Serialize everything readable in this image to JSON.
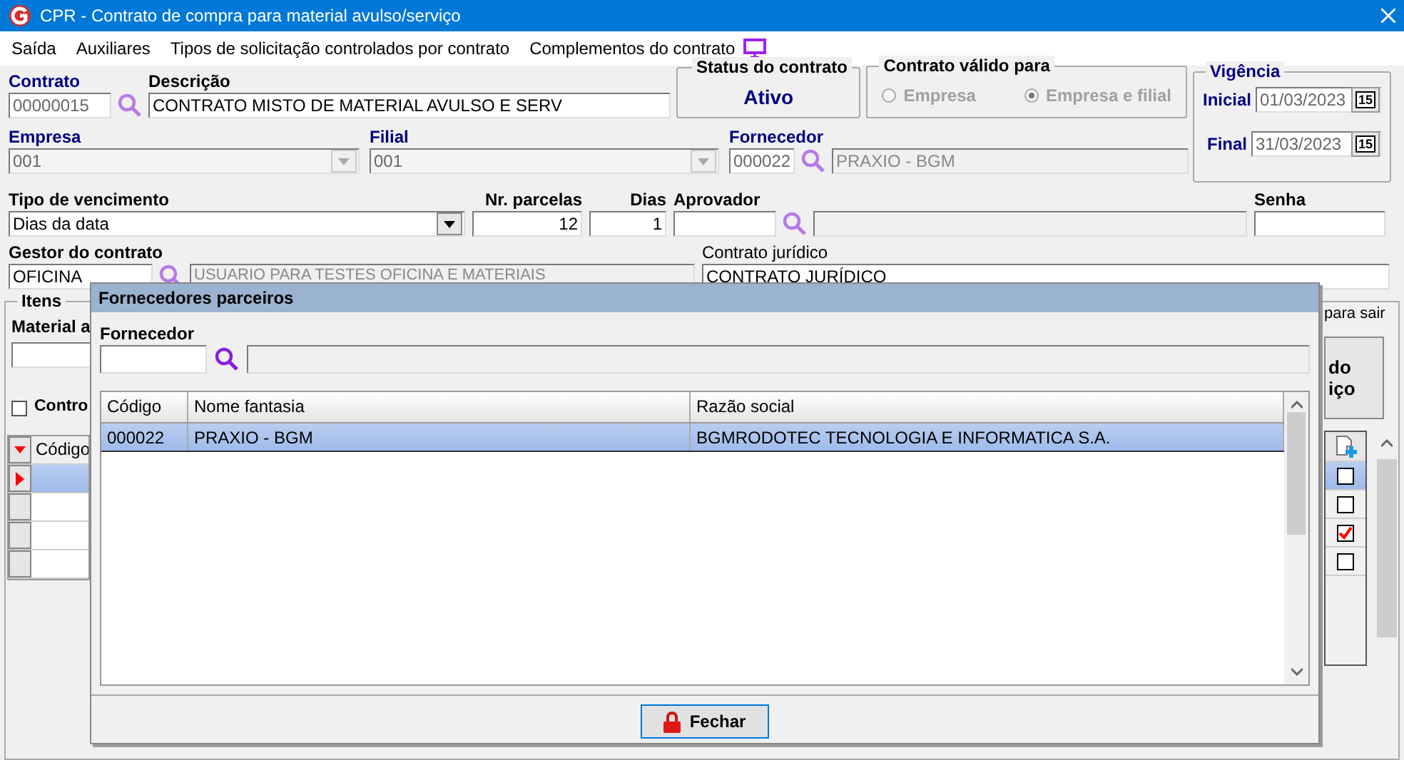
{
  "window": {
    "title": "CPR - Contrato de compra para material avulso/serviço"
  },
  "menu": [
    {
      "label": "Saída",
      "kind": "text"
    },
    {
      "label": "Auxiliares",
      "kind": "text"
    },
    {
      "label": "Tipos de solicitação controlados por contrato",
      "kind": "text"
    },
    {
      "label": "Complementos do contrato",
      "kind": "monitor"
    }
  ],
  "contrato": {
    "label": "Contrato",
    "value": "00000015",
    "required": true
  },
  "descricao": {
    "label": "Descrição",
    "value": "CONTRATO MISTO DE MATERIAL AVULSO E SERV",
    "required": false
  },
  "status": {
    "label": "Status do contrato",
    "value": "Ativo"
  },
  "valido_para": {
    "label": "Contrato válido para",
    "disabled": true,
    "options": [
      {
        "label": "Empresa",
        "selected": false
      },
      {
        "label": "Empresa e filial",
        "selected": true
      }
    ]
  },
  "vigencia": {
    "label": "Vigência",
    "inicial": {
      "label": "Inicial",
      "value": "01/03/2023",
      "calendar_day": "15"
    },
    "final": {
      "label": "Final",
      "value": "31/03/2023",
      "calendar_day": "15"
    }
  },
  "empresa": {
    "label": "Empresa",
    "value": "001",
    "required": true
  },
  "filial": {
    "label": "Filial",
    "value": "001",
    "required": true
  },
  "fornecedor": {
    "label": "Fornecedor",
    "code": "000022",
    "name": "PRAXIO - BGM",
    "required": true
  },
  "tipo_vencimento": {
    "label": "Tipo de vencimento",
    "value": "Dias da data",
    "required": false
  },
  "nr_parcelas": {
    "label": "Nr. parcelas",
    "value": "12",
    "required": false
  },
  "dias": {
    "label": "Dias",
    "value": "1",
    "required": false
  },
  "aprovador": {
    "label": "Aprovador",
    "required": false
  },
  "senha": {
    "label": "Senha",
    "required": false
  },
  "gestor": {
    "label": "Gestor do contrato",
    "value": "OFICINA",
    "name": "USUARIO PARA TESTES OFICINA E MATERIAIS",
    "required": false
  },
  "contrato_juridico": {
    "label": "Contrato jurídico",
    "value": "CONTRATO JURÍDICO"
  },
  "itens": {
    "label": "Itens",
    "material_label": "Material a",
    "checkbox": {
      "label": "Contro",
      "checked": false
    },
    "hint": "para sair",
    "button_lines": [
      "do",
      "iço"
    ],
    "grid": {
      "column_1": "Código",
      "rows": [
        {
          "selected": true,
          "checked": false
        },
        {
          "selected": false,
          "checked": false
        },
        {
          "selected": false,
          "checked": true
        },
        {
          "selected": false,
          "checked": false
        }
      ]
    }
  },
  "dialog": {
    "title": "Fornecedores parceiros",
    "fornecedor_label": "Fornecedor",
    "columns": [
      "Código",
      "Nome fantasia",
      "Razão social"
    ],
    "rows": [
      {
        "cells": [
          "000022",
          "PRAXIO - BGM",
          "BGMRODOTEC TECNOLOGIA E INFORMATICA S.A."
        ],
        "selected": true
      }
    ],
    "close_button": "Fechar"
  }
}
